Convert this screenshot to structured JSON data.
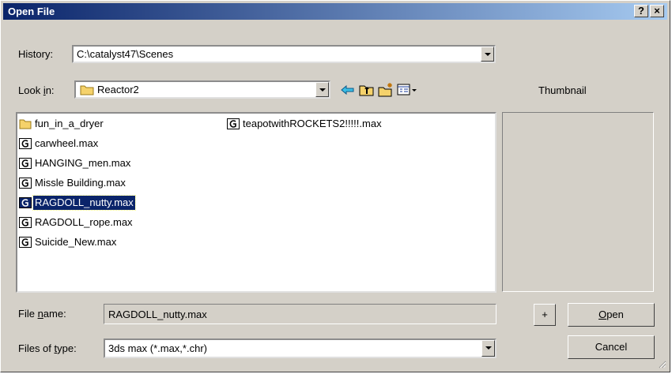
{
  "window": {
    "title": "Open File",
    "help_label": "?",
    "close_label": "×"
  },
  "history": {
    "label": "History:",
    "value": "C:\\catalyst47\\Scenes"
  },
  "lookin": {
    "label_pre": "Look ",
    "label_u": "i",
    "label_post": "n:",
    "value": "Reactor2",
    "toolbar_icons": [
      "back-arrow-icon",
      "up-folder-icon",
      "new-folder-icon",
      "view-menu-icon"
    ]
  },
  "files": [
    {
      "name": "fun_in_a_dryer",
      "type": "folder",
      "selected": false
    },
    {
      "name": "carwheel.max",
      "type": "max-file",
      "selected": false
    },
    {
      "name": "HANGING_men.max",
      "type": "max-file",
      "selected": false
    },
    {
      "name": "Missle Building.max",
      "type": "max-file",
      "selected": false
    },
    {
      "name": "RAGDOLL_nutty.max",
      "type": "max-file",
      "selected": true
    },
    {
      "name": "RAGDOLL_rope.max",
      "type": "max-file",
      "selected": false
    },
    {
      "name": "Suicide_New.max",
      "type": "max-file",
      "selected": false
    },
    {
      "name": "teapotwithROCKETS2!!!!!.max",
      "type": "max-file",
      "selected": false
    }
  ],
  "thumbnail": {
    "label": "Thumbnail"
  },
  "filename": {
    "label_pre": "File ",
    "label_u": "n",
    "label_post": "ame:",
    "value": "RAGDOLL_nutty.max"
  },
  "filetype": {
    "label_pre": "Files of ",
    "label_u": "t",
    "label_post": "ype:",
    "value": "3ds max (*.max,*.chr)"
  },
  "buttons": {
    "plus": "+",
    "open_u": "O",
    "open_rest": "pen",
    "cancel": "Cancel"
  },
  "colors": {
    "title_start": "#0a246a",
    "title_end": "#a6caf0",
    "face": "#d4d0c8",
    "selection": "#0a246a"
  }
}
